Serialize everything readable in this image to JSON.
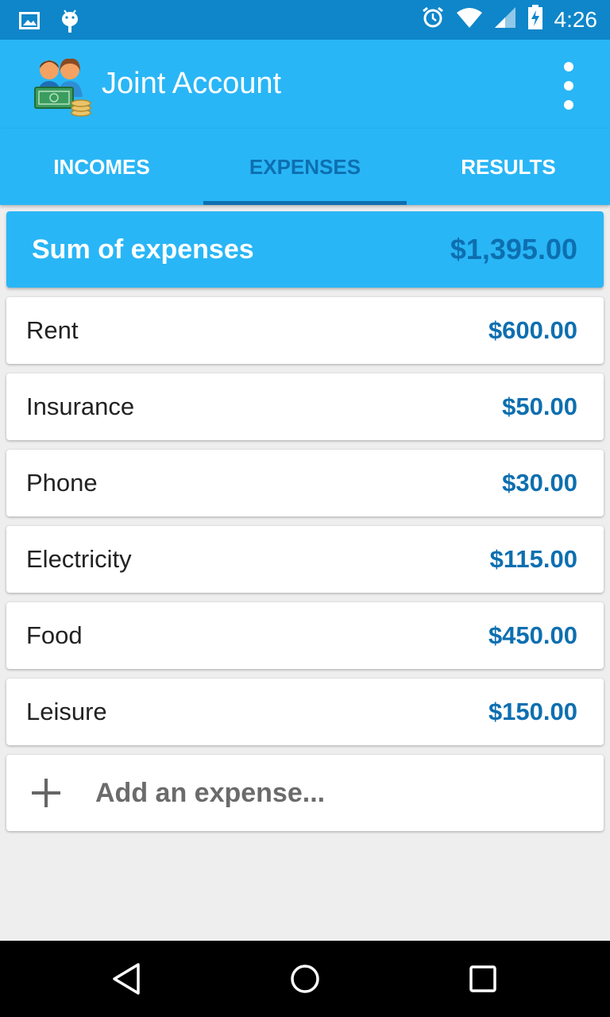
{
  "status_bar": {
    "time": "4:26",
    "left_icons": [
      "image-icon",
      "android-debug-icon"
    ],
    "right_icons": [
      "alarm-icon",
      "wifi-icon",
      "cellular-signal-icon",
      "battery-charging-icon"
    ]
  },
  "app_bar": {
    "title": "Joint Account",
    "logo_icon": "couple-money-icon",
    "menu_icon": "overflow-menu-icon"
  },
  "tabs": [
    {
      "label": "INCOMES",
      "active": false
    },
    {
      "label": "EXPENSES",
      "active": true
    },
    {
      "label": "RESULTS",
      "active": false
    }
  ],
  "summary": {
    "label": "Sum of expenses",
    "value": "$1,395.00"
  },
  "expenses": [
    {
      "name": "Rent",
      "amount": "$600.00"
    },
    {
      "name": "Insurance",
      "amount": "$50.00"
    },
    {
      "name": "Phone",
      "amount": "$30.00"
    },
    {
      "name": "Electricity",
      "amount": "$115.00"
    },
    {
      "name": "Food",
      "amount": "$450.00"
    },
    {
      "name": "Leisure",
      "amount": "$150.00"
    }
  ],
  "add_expense": {
    "label": "Add an expense...",
    "icon": "plus-icon"
  },
  "nav_bar": {
    "buttons": [
      "back-icon",
      "home-icon",
      "recents-icon"
    ]
  },
  "colors": {
    "status_bar": "#0e86c9",
    "primary": "#29b6f6",
    "accent": "#0d6fb0",
    "background": "#eeeeee"
  }
}
